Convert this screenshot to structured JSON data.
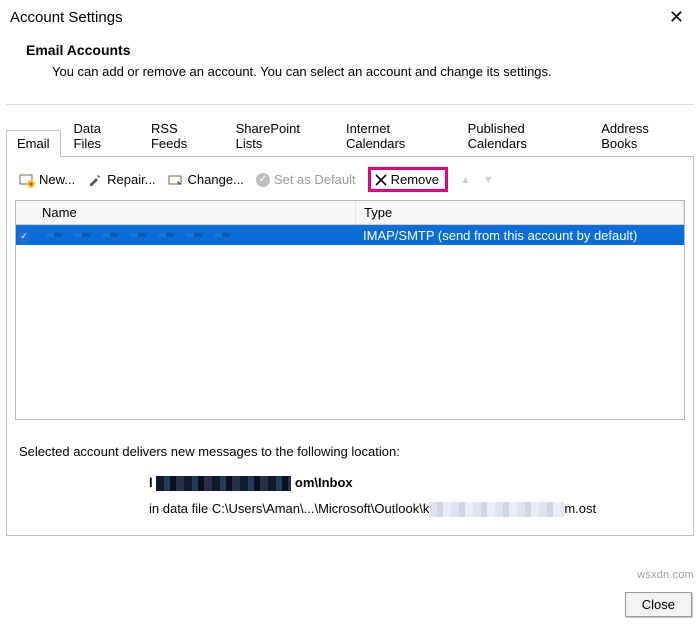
{
  "window": {
    "title": "Account Settings",
    "close_label": "Close"
  },
  "header": {
    "title": "Email Accounts",
    "description": "You can add or remove an account. You can select an account and change its settings."
  },
  "tabs": [
    {
      "label": "Email",
      "active": true
    },
    {
      "label": "Data Files"
    },
    {
      "label": "RSS Feeds"
    },
    {
      "label": "SharePoint Lists"
    },
    {
      "label": "Internet Calendars"
    },
    {
      "label": "Published Calendars"
    },
    {
      "label": "Address Books"
    }
  ],
  "toolbar": {
    "new_label": "New...",
    "repair_label": "Repair...",
    "change_label": "Change...",
    "set_default_label": "Set as Default",
    "remove_label": "Remove"
  },
  "grid": {
    "columns": {
      "name": "Name",
      "type": "Type"
    },
    "rows": [
      {
        "name": "",
        "type": "IMAP/SMTP (send from this account by default)",
        "selected": true,
        "default": true
      }
    ]
  },
  "info": {
    "intro": "Selected account delivers new messages to the following location:",
    "mailbox_prefix": "l",
    "mailbox_suffix": "om\\Inbox",
    "path_prefix": "in data file C:\\Users\\Aman\\...\\Microsoft\\Outlook\\k",
    "path_suffix": "m.ost"
  },
  "watermark": "wsxdn.com"
}
